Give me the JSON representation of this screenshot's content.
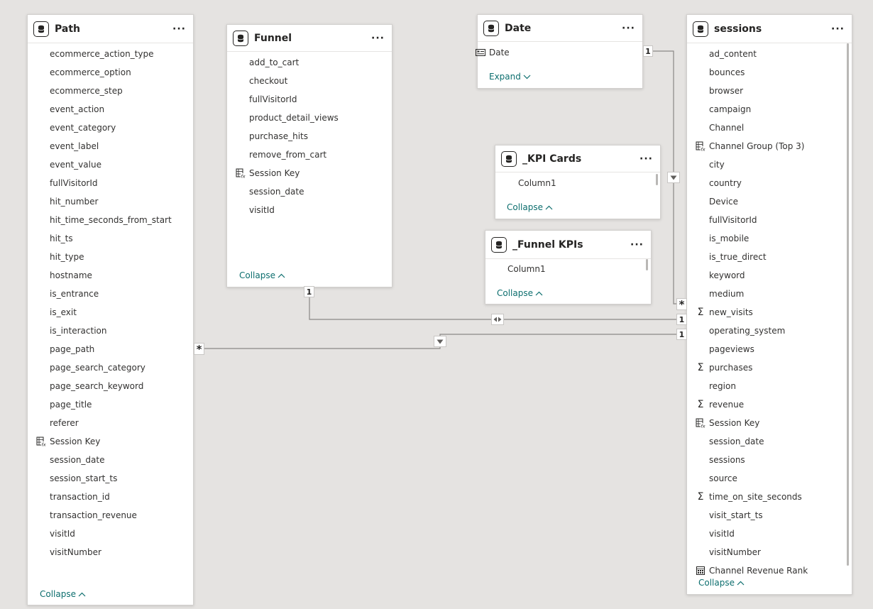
{
  "tables": {
    "path": {
      "title": "Path",
      "fields": [
        {
          "label": "ecommerce_action_type",
          "icon": "none"
        },
        {
          "label": "ecommerce_option",
          "icon": "none"
        },
        {
          "label": "ecommerce_step",
          "icon": "none"
        },
        {
          "label": "event_action",
          "icon": "none"
        },
        {
          "label": "event_category",
          "icon": "none"
        },
        {
          "label": "event_label",
          "icon": "none"
        },
        {
          "label": "event_value",
          "icon": "none"
        },
        {
          "label": "fullVisitorId",
          "icon": "none"
        },
        {
          "label": "hit_number",
          "icon": "none"
        },
        {
          "label": "hit_time_seconds_from_start",
          "icon": "none"
        },
        {
          "label": "hit_ts",
          "icon": "none"
        },
        {
          "label": "hit_type",
          "icon": "none"
        },
        {
          "label": "hostname",
          "icon": "none"
        },
        {
          "label": "is_entrance",
          "icon": "none"
        },
        {
          "label": "is_exit",
          "icon": "none"
        },
        {
          "label": "is_interaction",
          "icon": "none"
        },
        {
          "label": "page_path",
          "icon": "none"
        },
        {
          "label": "page_search_category",
          "icon": "none"
        },
        {
          "label": "page_search_keyword",
          "icon": "none"
        },
        {
          "label": "page_title",
          "icon": "none"
        },
        {
          "label": "referer",
          "icon": "none"
        },
        {
          "label": "Session Key",
          "icon": "calculated-column-icon"
        },
        {
          "label": "session_date",
          "icon": "none"
        },
        {
          "label": "session_start_ts",
          "icon": "none"
        },
        {
          "label": "transaction_id",
          "icon": "none"
        },
        {
          "label": "transaction_revenue",
          "icon": "none"
        },
        {
          "label": "visitId",
          "icon": "none"
        },
        {
          "label": "visitNumber",
          "icon": "none"
        }
      ],
      "toggle_label": "Collapse"
    },
    "funnel": {
      "title": "Funnel",
      "fields": [
        {
          "label": "add_to_cart",
          "icon": "none"
        },
        {
          "label": "checkout",
          "icon": "none"
        },
        {
          "label": "fullVisitorId",
          "icon": "none"
        },
        {
          "label": "product_detail_views",
          "icon": "none"
        },
        {
          "label": "purchase_hits",
          "icon": "none"
        },
        {
          "label": "remove_from_cart",
          "icon": "none"
        },
        {
          "label": "Session Key",
          "icon": "calculated-column-icon"
        },
        {
          "label": "session_date",
          "icon": "none"
        },
        {
          "label": "visitId",
          "icon": "none"
        }
      ],
      "toggle_label": "Collapse"
    },
    "date": {
      "title": "Date",
      "fields": [
        {
          "label": "Date",
          "icon": "date-hierarchy-icon"
        }
      ],
      "toggle_label": "Expand"
    },
    "kpi_cards": {
      "title": "_KPI Cards",
      "fields": [
        {
          "label": "Column1",
          "icon": "none"
        }
      ],
      "toggle_label": "Collapse"
    },
    "funnel_kpis": {
      "title": "_Funnel KPIs",
      "fields": [
        {
          "label": "Column1",
          "icon": "none"
        }
      ],
      "toggle_label": "Collapse"
    },
    "sessions": {
      "title": "sessions",
      "fields": [
        {
          "label": "ad_content",
          "icon": "none"
        },
        {
          "label": "bounces",
          "icon": "none"
        },
        {
          "label": "browser",
          "icon": "none"
        },
        {
          "label": "campaign",
          "icon": "none"
        },
        {
          "label": "Channel",
          "icon": "none"
        },
        {
          "label": "Channel Group (Top 3)",
          "icon": "calculated-column-icon"
        },
        {
          "label": "city",
          "icon": "none"
        },
        {
          "label": "country",
          "icon": "none"
        },
        {
          "label": "Device",
          "icon": "none"
        },
        {
          "label": "fullVisitorId",
          "icon": "none"
        },
        {
          "label": "is_mobile",
          "icon": "none"
        },
        {
          "label": "is_true_direct",
          "icon": "none"
        },
        {
          "label": "keyword",
          "icon": "none"
        },
        {
          "label": "medium",
          "icon": "none"
        },
        {
          "label": "new_visits",
          "icon": "sigma-icon"
        },
        {
          "label": "operating_system",
          "icon": "none"
        },
        {
          "label": "pageviews",
          "icon": "none"
        },
        {
          "label": "purchases",
          "icon": "sigma-icon"
        },
        {
          "label": "region",
          "icon": "none"
        },
        {
          "label": "revenue",
          "icon": "sigma-icon"
        },
        {
          "label": "Session Key",
          "icon": "calculated-column-icon"
        },
        {
          "label": "session_date",
          "icon": "none"
        },
        {
          "label": "sessions",
          "icon": "none"
        },
        {
          "label": "source",
          "icon": "none"
        },
        {
          "label": "time_on_site_seconds",
          "icon": "sigma-icon"
        },
        {
          "label": "visit_start_ts",
          "icon": "none"
        },
        {
          "label": "visitId",
          "icon": "none"
        },
        {
          "label": "visitNumber",
          "icon": "none"
        },
        {
          "label": "Channel Revenue Rank",
          "icon": "measure-icon"
        }
      ],
      "toggle_label": "Collapse"
    }
  },
  "relationships": {
    "date_sessions": {
      "from_card": "1",
      "to_card": "*"
    },
    "funnel_sessions": {
      "from_card": "1",
      "to_card": "1"
    },
    "path_sessions": {
      "from_card": "*",
      "to_card": "1"
    }
  }
}
